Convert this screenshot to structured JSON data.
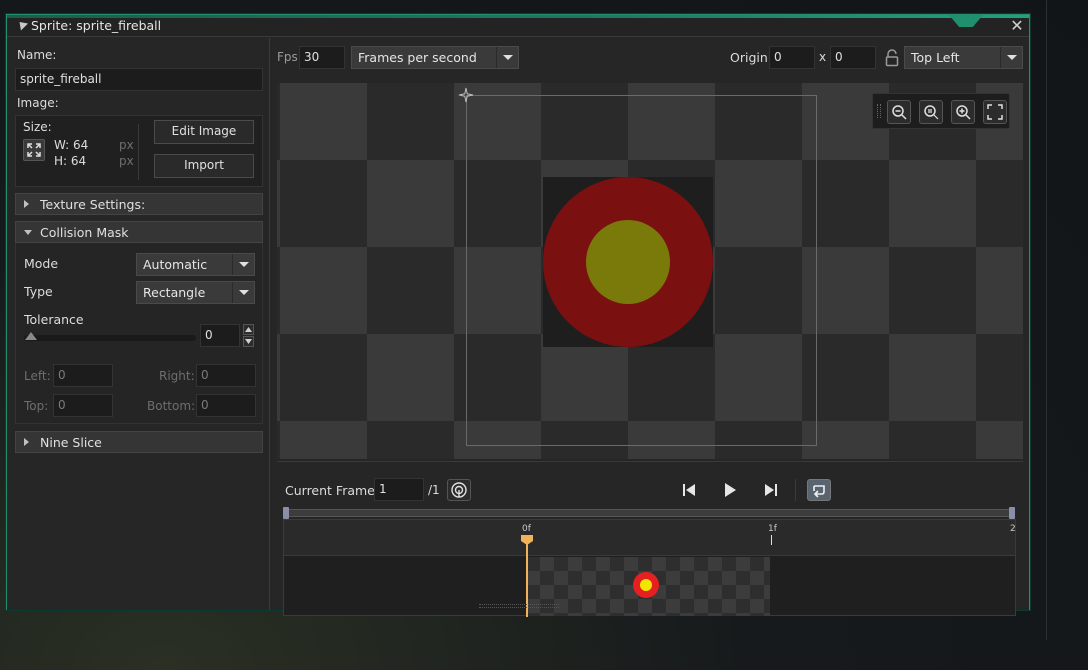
{
  "window": {
    "title": "Sprite: sprite_fireball",
    "close_glyph": "✕"
  },
  "left": {
    "name_label": "Name:",
    "name_value": "sprite_fireball",
    "image_label": "Image:",
    "size_label": "Size:",
    "width_text": "W: 64",
    "height_text": "H: 64",
    "px1": "px",
    "px2": "px",
    "edit_image": "Edit Image",
    "import": "Import",
    "texture_settings": "Texture Settings:",
    "collision_mask": "Collision Mask",
    "mode_label": "Mode",
    "mode_value": "Automatic",
    "type_label": "Type",
    "type_value": "Rectangle",
    "tolerance_label": "Tolerance",
    "tolerance_value": "0",
    "left_label": "Left:",
    "left_value": "0",
    "right_label": "Right:",
    "right_value": "0",
    "top_label": "Top:",
    "top_value": "0",
    "bottom_label": "Bottom:",
    "bottom_value": "0",
    "nine_slice": "Nine Slice"
  },
  "toolbar": {
    "fps_label": "Fps",
    "fps_value": "30",
    "fps_mode": "Frames per second",
    "origin_label": "Origin",
    "origin_x": "0",
    "x_sep": "x",
    "origin_y": "0",
    "origin_preset": "Top Left"
  },
  "playback": {
    "current_frame_label": "Current Frame:",
    "current_frame_value": "1",
    "total_frames": "/1"
  },
  "timeline": {
    "ruler_labels": [
      "0f",
      "1f",
      "2"
    ]
  },
  "colors": {
    "accent": "#1f8f6e",
    "sprite_outer": "#7a1010",
    "sprite_inner": "#7a7a0a",
    "thumb_outer": "#e52020",
    "thumb_inner": "#f2e600",
    "playhead": "#f0b35a"
  },
  "icons": [
    "close-icon",
    "fit-icon",
    "lock-icon",
    "origin-icon",
    "zoom-out-icon",
    "zoom-reset-icon",
    "zoom-in-icon",
    "fullscreen-icon",
    "onion-skin-icon",
    "skip-start-icon",
    "play-icon",
    "skip-end-icon",
    "loop-icon"
  ]
}
